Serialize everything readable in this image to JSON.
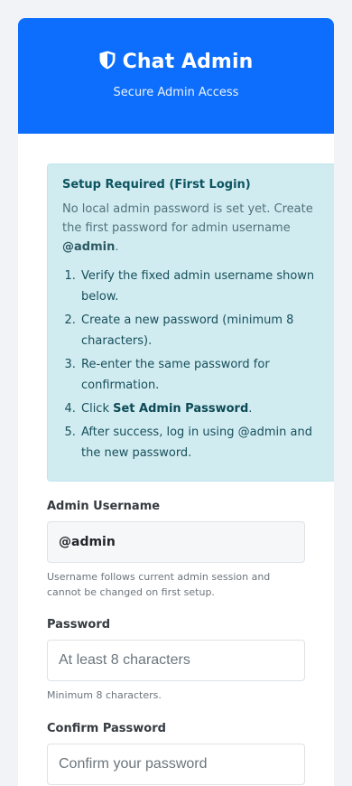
{
  "header": {
    "title": "Chat Admin",
    "subtitle": "Secure Admin Access",
    "icon": "shield-icon",
    "color": "#0d6efd"
  },
  "alert": {
    "title": "Setup Required (First Login)",
    "desc_pre": "No local admin password is set yet. Create the first password for admin username ",
    "desc_username": "@admin",
    "desc_post": ".",
    "steps": [
      "Verify the fixed admin username shown below.",
      "Create a new password (minimum 8 characters).",
      "Re-enter the same password for confirmation.",
      "Set Admin Password",
      "After success, log in using @admin and the new password."
    ],
    "step4_pre": "Click ",
    "step4_post": "."
  },
  "form": {
    "username": {
      "label": "Admin Username",
      "value": "@admin",
      "hint": "Username follows current admin session and cannot be changed on first setup."
    },
    "password": {
      "label": "Password",
      "placeholder": "At least 8 characters",
      "hint": "Minimum 8 characters."
    },
    "confirm": {
      "label": "Confirm Password",
      "placeholder": "Confirm your password"
    }
  }
}
